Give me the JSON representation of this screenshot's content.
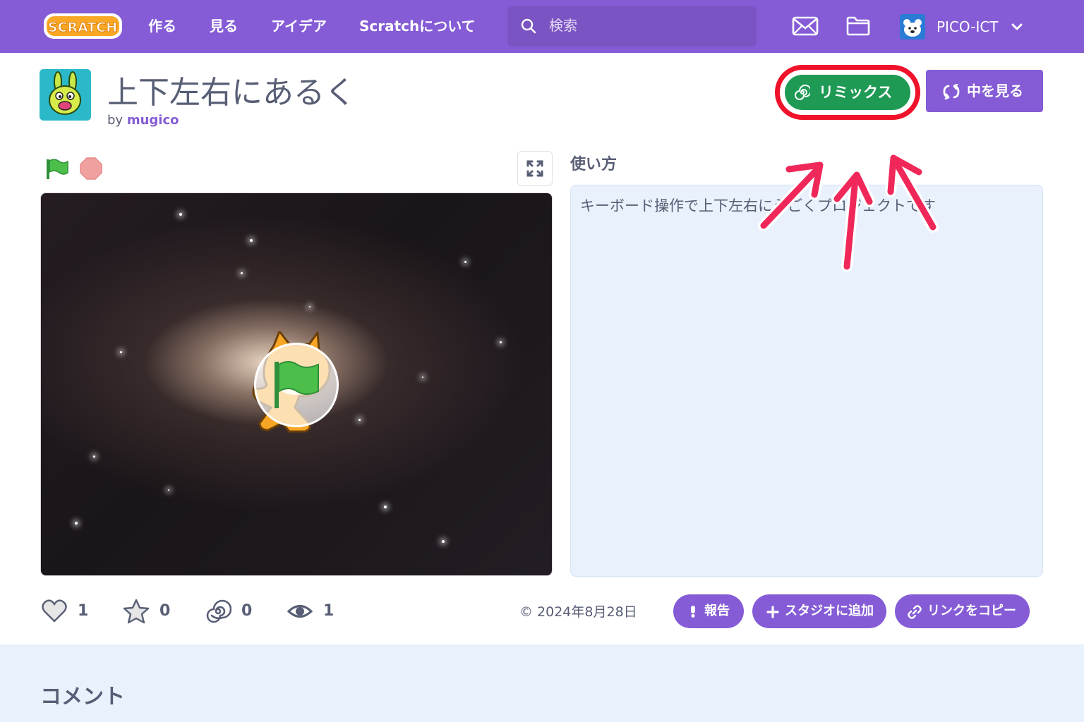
{
  "nav": {
    "logo_text": "SCRATCH",
    "links": [
      "作る",
      "見る",
      "アイデア",
      "Scratchについて"
    ],
    "search_placeholder": "検索",
    "username": "PICO-ICT"
  },
  "project": {
    "title": "上下左右にあるく",
    "by": "by",
    "author": "mugico",
    "remix_label": "リミックス",
    "see_inside_label": "中を見る"
  },
  "instructions": {
    "label": "使い方",
    "text": "キーボード操作で上下左右にうごくプロジェクトです"
  },
  "stats": {
    "loves": "1",
    "favorites": "0",
    "remixes": "0",
    "views": "1"
  },
  "date": "© 2024年8月28日",
  "actions": {
    "report": "報告",
    "add_to_studio": "スタジオに追加",
    "copy_link": "リンクをコピー"
  },
  "comments": {
    "title": "コメント"
  },
  "colors": {
    "nav_purple": "#855cd6",
    "remix_green": "#1f9a55",
    "highlight_red": "#f0112a",
    "annotation_pink": "#f0285a"
  }
}
